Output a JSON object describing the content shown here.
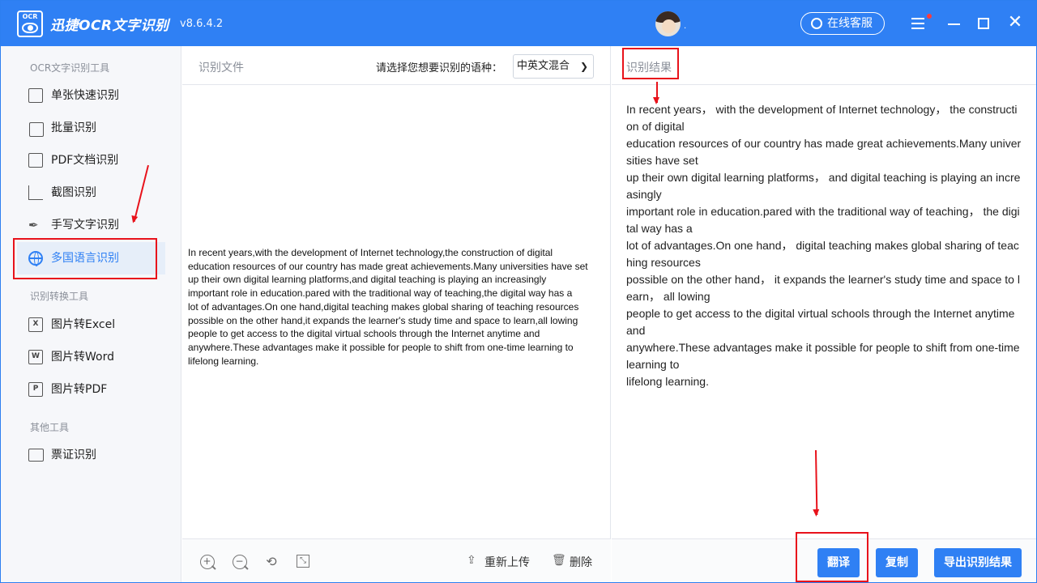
{
  "titlebar": {
    "logo_text": "OCR",
    "app_title": "迅捷OCR文字识别",
    "version": "v8.6.4.2",
    "avatar_suffix": ".",
    "service_label": "在线客服"
  },
  "sidebar": {
    "section1": "OCR文字识别工具",
    "items1": [
      {
        "label": "单张快速识别"
      },
      {
        "label": "批量识别"
      },
      {
        "label": "PDF文档识别"
      },
      {
        "label": "截图识别"
      },
      {
        "label": "手写文字识别"
      },
      {
        "label": "多国语言识别"
      }
    ],
    "section2": "识别转换工具",
    "items2": [
      {
        "label": "图片转Excel",
        "icon": "X"
      },
      {
        "label": "图片转Word",
        "icon": "W"
      },
      {
        "label": "图片转PDF",
        "icon": "P"
      }
    ],
    "section3": "其他工具",
    "items3": [
      {
        "label": "票证识别"
      }
    ]
  },
  "middle": {
    "title": "识别文件",
    "lang_label": "请选择您想要识别的语种：",
    "lang_value": "中英文混合",
    "document_text": "In recent years,with the development of Internet technology,the construction of digital\neducation resources of our country has made great achievements.Many universities have set\nup their own digital learning platforms,and digital teaching is playing an increasingly\nimportant role in education.pared with the traditional way of teaching,the digital way has a\nlot of advantages.On one hand,digital teaching makes global sharing of teaching resources\npossible on the other hand,it expands the learner's study time and space to learn,all lowing\npeople to get access to the digital virtual schools through the Internet anytime and\nanywhere.These advantages make it possible for people to shift from one-time learning to\nlifelong learning.",
    "reupload_label": "重新上传",
    "delete_label": "删除"
  },
  "right": {
    "title": "识别结果",
    "result_text": "In recent years， with the development of Internet technology， the construction of digital\neducation resources of our country has made great achievements.Many universities have set\nup their own digital learning platforms， and digital teaching is playing an increasingly\nimportant role in education.pared with the traditional way of teaching， the digital way has a\nlot of advantages.On one hand， digital teaching makes global sharing of teaching resources\npossible on the other hand， it expands the learner's study time and space to learn， all lowing\npeople to get access to the digital virtual schools through the Internet anytime and\nanywhere.These advantages make it possible for people to shift from one-time learning to\nlifelong learning.",
    "translate_label": "翻译",
    "copy_label": "复制",
    "export_label": "导出识别结果"
  },
  "colors": {
    "primary": "#2f80f4",
    "annotation": "#e8121b"
  }
}
